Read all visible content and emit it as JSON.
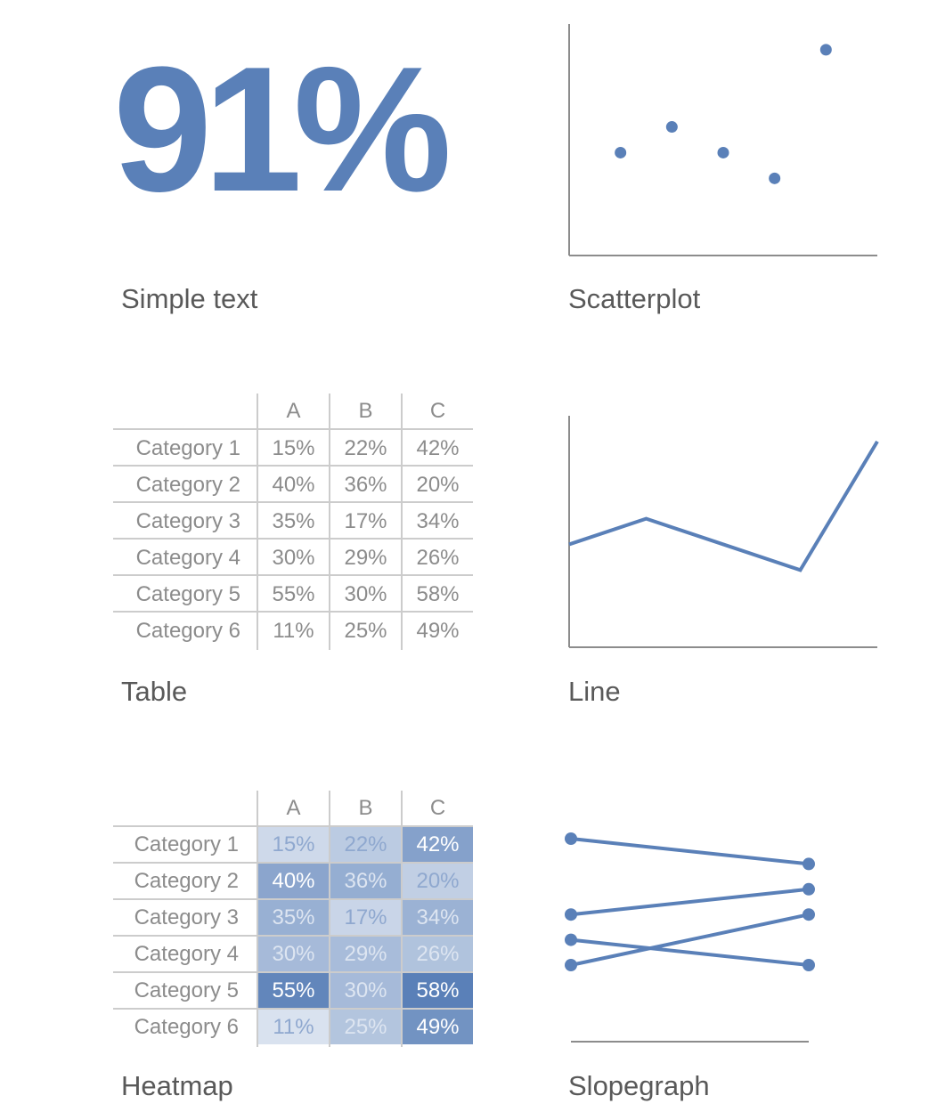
{
  "simple_text": {
    "value": "91%",
    "caption": "Simple text"
  },
  "captions": {
    "scatterplot": "Scatterplot",
    "table": "Table",
    "line": "Line",
    "heatmap": "Heatmap",
    "slopegraph": "Slopegraph"
  },
  "colors": {
    "accent": "#5a80b8",
    "axis": "#8c8c8c",
    "text": "#595959",
    "table_text": "#8c8c8c"
  },
  "chart_data": [
    {
      "type": "scatter",
      "x": [
        1,
        2,
        3,
        4,
        5
      ],
      "y": [
        4,
        5,
        4,
        3,
        8
      ],
      "xlim": [
        0,
        6
      ],
      "ylim": [
        0,
        9
      ],
      "grid": false
    },
    {
      "type": "table",
      "columns": [
        "A",
        "B",
        "C"
      ],
      "rows": [
        {
          "label": "Category 1",
          "values": [
            "15%",
            "22%",
            "42%"
          ]
        },
        {
          "label": "Category 2",
          "values": [
            "40%",
            "36%",
            "20%"
          ]
        },
        {
          "label": "Category 3",
          "values": [
            "35%",
            "17%",
            "34%"
          ]
        },
        {
          "label": "Category 4",
          "values": [
            "30%",
            "29%",
            "26%"
          ]
        },
        {
          "label": "Category 5",
          "values": [
            "55%",
            "30%",
            "58%"
          ]
        },
        {
          "label": "Category 6",
          "values": [
            "11%",
            "25%",
            "49%"
          ]
        }
      ]
    },
    {
      "type": "line",
      "x": [
        0,
        1,
        2,
        3,
        4
      ],
      "y": [
        4,
        5,
        4,
        3,
        8
      ],
      "ylim": [
        0,
        9
      ],
      "grid": false
    },
    {
      "type": "heatmap",
      "columns": [
        "A",
        "B",
        "C"
      ],
      "rows": [
        "Category 1",
        "Category 2",
        "Category 3",
        "Category 4",
        "Category 5",
        "Category 6"
      ],
      "values": [
        [
          15,
          22,
          42
        ],
        [
          40,
          36,
          20
        ],
        [
          35,
          17,
          34
        ],
        [
          30,
          29,
          26
        ],
        [
          55,
          30,
          58
        ],
        [
          11,
          25,
          49
        ]
      ],
      "unit": "%"
    },
    {
      "type": "line",
      "subtype": "slopegraph",
      "series": [
        {
          "values": [
            10,
            9
          ]
        },
        {
          "values": [
            7,
            8
          ]
        },
        {
          "values": [
            6,
            5
          ]
        },
        {
          "values": [
            5,
            7
          ]
        }
      ],
      "ylim": [
        3,
        10.5
      ]
    }
  ]
}
